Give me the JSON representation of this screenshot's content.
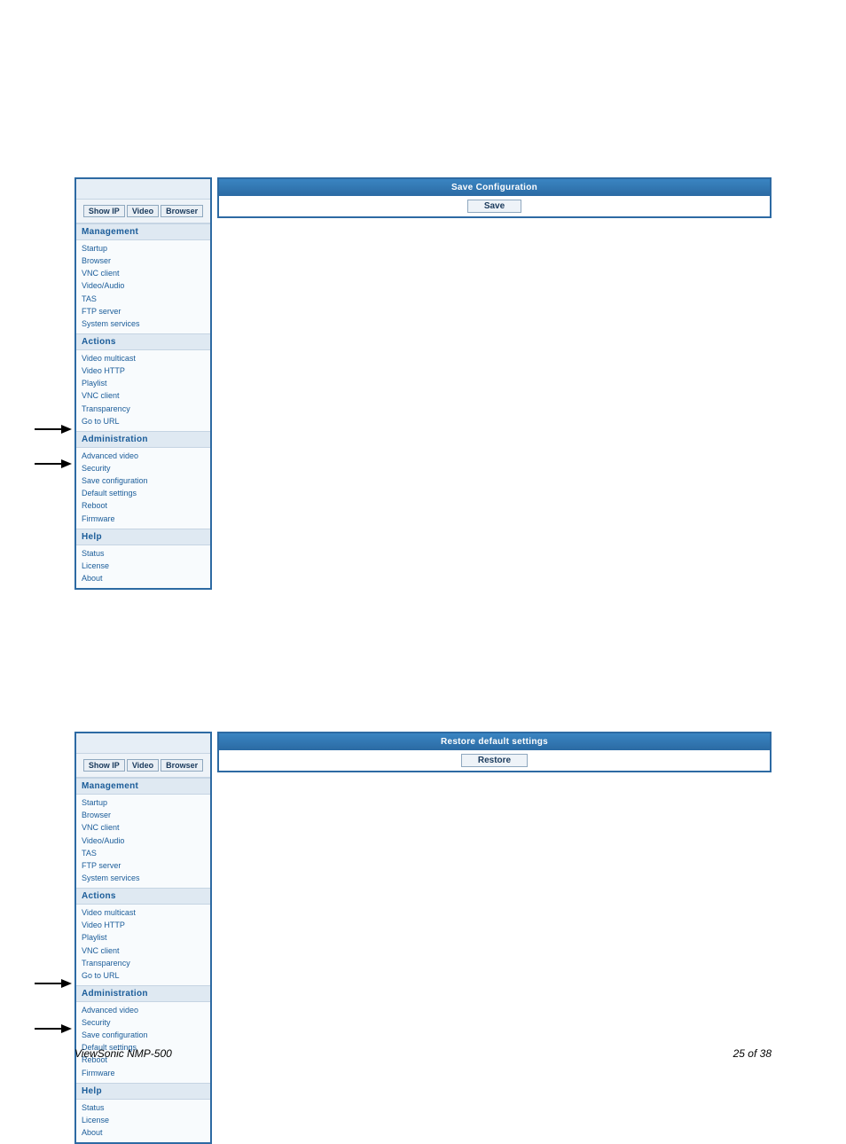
{
  "sidebar": {
    "buttons": {
      "show_ip": "Show IP",
      "video": "Video",
      "browser": "Browser"
    },
    "sections": {
      "management": {
        "title": "Management",
        "items": [
          "Startup",
          "Browser",
          "VNC client",
          "Video/Audio",
          "TAS",
          "FTP server",
          "System services"
        ]
      },
      "actions": {
        "title": "Actions",
        "items": [
          "Video multicast",
          "Video HTTP",
          "Playlist",
          "VNC client",
          "Transparency",
          "Go to URL"
        ]
      },
      "administration": {
        "title": "Administration",
        "items": [
          "Advanced video",
          "Security",
          "Save configuration",
          "Default settings",
          "Reboot",
          "Firmware"
        ]
      },
      "help": {
        "title": "Help",
        "items": [
          "Status",
          "License",
          "About"
        ]
      }
    }
  },
  "panels": {
    "save": {
      "title": "Save Configuration",
      "button": "Save"
    },
    "restore": {
      "title": "Restore default settings",
      "button": "Restore"
    }
  },
  "footer": {
    "left": "ViewSonic NMP-500",
    "right": "25 of  38"
  }
}
